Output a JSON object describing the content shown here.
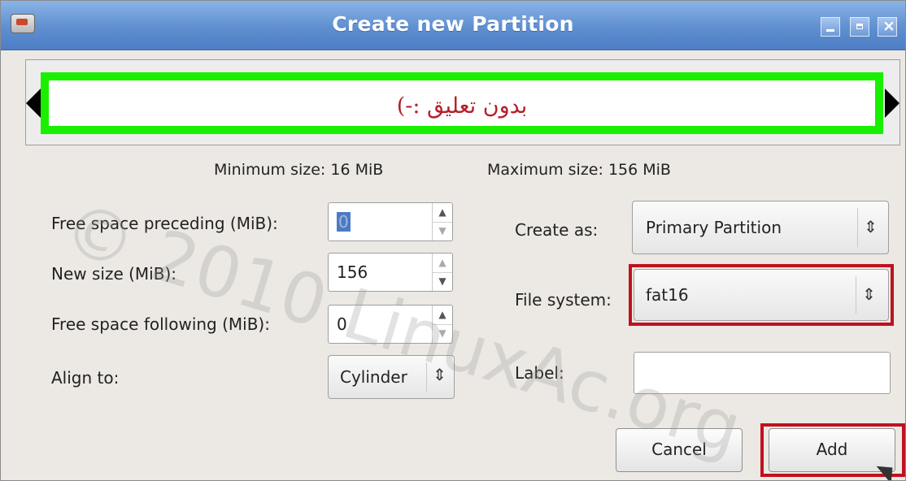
{
  "window": {
    "title": "Create new Partition"
  },
  "partition_graphic": {
    "caption": "بدون تعليق :-)"
  },
  "size_info": {
    "minimum": "Minimum size: 16 MiB",
    "maximum": "Maximum size: 156 MiB"
  },
  "left_fields": {
    "free_preceding": {
      "label": "Free space preceding (MiB):",
      "value": "0"
    },
    "new_size": {
      "label": "New size (MiB):",
      "value": "156"
    },
    "free_following": {
      "label": "Free space following (MiB):",
      "value": "0"
    },
    "align_to": {
      "label": "Align to:",
      "value": "Cylinder"
    }
  },
  "right_fields": {
    "create_as": {
      "label": "Create as:",
      "value": "Primary Partition"
    },
    "file_system": {
      "label": "File system:",
      "value": "fat16"
    },
    "label": {
      "label": "Label:",
      "value": ""
    }
  },
  "buttons": {
    "cancel": "Cancel",
    "add": "Add"
  },
  "watermark": "© 2010 LinuxAc.org",
  "colors": {
    "partition_border": "#19f000",
    "highlight": "#c0111f",
    "caption": "#b5202b"
  }
}
